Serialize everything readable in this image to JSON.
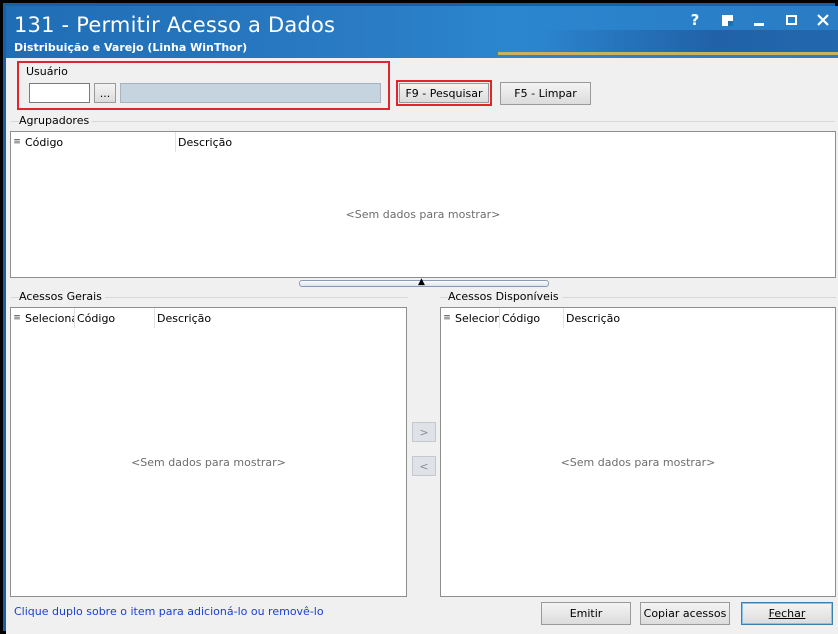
{
  "window": {
    "title": "131 - Permitir Acesso a Dados",
    "subtitle": "Distribuição e Varejo (Linha WinThor)",
    "help_label": "?"
  },
  "search": {
    "user_label": "Usuário",
    "user_code_value": "",
    "ellipsis_label": "...",
    "user_name_value": "",
    "search_button": "F9 - Pesquisar",
    "clear_button": "F5 - Limpar"
  },
  "agrupadores": {
    "title": "Agrupadores",
    "columns": [
      "Código",
      "Descrição"
    ],
    "empty": "<Sem dados para mostrar>"
  },
  "acessos_gerais": {
    "title": "Acessos Gerais",
    "columns": [
      "Selecionado",
      "Código",
      "Descrição"
    ],
    "empty": "<Sem dados para mostrar>"
  },
  "acessos_disponiveis": {
    "title": "Acessos Disponíveis",
    "columns": [
      "Selecionado",
      "Código",
      "Descrição"
    ],
    "empty": "<Sem dados para mostrar>"
  },
  "transfer": {
    "add_label": ">",
    "remove_label": "<"
  },
  "footer": {
    "hint": "Clique duplo sobre o item para adicioná-lo ou removê-lo",
    "emit_button": "Emitir",
    "copy_button": "Copiar acessos",
    "close_button": "Fechar"
  },
  "colors": {
    "titlebar": "#1f6db5",
    "highlight_border": "#e0262b",
    "hint_text": "#1c3fd1"
  }
}
